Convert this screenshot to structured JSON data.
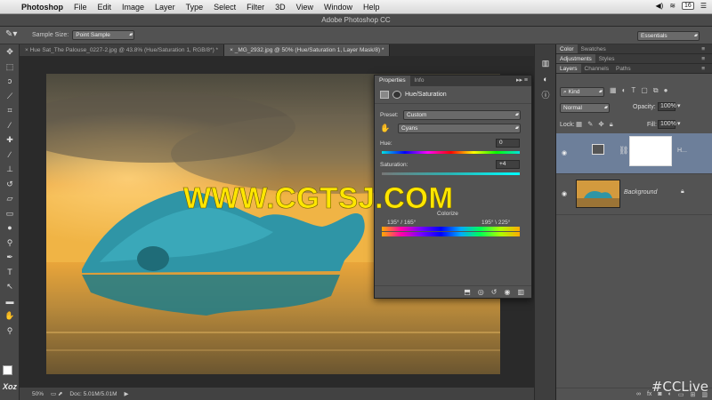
{
  "menubar": {
    "app": "Photoshop",
    "items": [
      "File",
      "Edit",
      "Image",
      "Layer",
      "Type",
      "Select",
      "Filter",
      "3D",
      "View",
      "Window",
      "Help"
    ],
    "calendar_day": "16"
  },
  "window": {
    "title": "Adobe Photoshop CC"
  },
  "options": {
    "sample_size_label": "Sample Size:",
    "sample_size_value": "Point Sample",
    "workspace": "Essentials"
  },
  "doc_tabs": [
    {
      "label": "Hue Sat_The Palouse_0227-2.jpg @ 43.8% (Hue/Saturation 1, RGB/8*) *"
    },
    {
      "label": "_MG_2932.jpg @ 50% (Hue/Saturation 1, Layer Mask/8) *"
    }
  ],
  "status": {
    "zoom": "50%",
    "doc": "Doc: 5.01M/5.01M"
  },
  "properties": {
    "tabs": [
      "Properties",
      "Info"
    ],
    "adjustment": "Hue/Saturation",
    "preset_label": "Preset:",
    "preset_value": "Custom",
    "channel": "Cyans",
    "hue_label": "Hue:",
    "hue_value": "0",
    "saturation_label": "Saturation:",
    "saturation_value": "+4",
    "colorize_label": "Colorize",
    "range_left": "135° / 165°",
    "range_right": "195° \\ 225°"
  },
  "right": {
    "top_tabs": [
      "Color",
      "Swatches"
    ],
    "mid_tabs": [
      "Adjustments",
      "Styles"
    ],
    "layer_tabs": [
      "Layers",
      "Channels",
      "Paths"
    ],
    "kind": "Kind",
    "blend_mode": "Normal",
    "opacity_label": "Opacity:",
    "opacity_value": "100%",
    "lock_label": "Lock:",
    "fill_label": "Fill:",
    "fill_value": "100%",
    "layers": [
      {
        "name": "H..."
      },
      {
        "name": "Background"
      }
    ]
  },
  "overlay": {
    "watermark": "WWW.CGTSJ.COM",
    "tag": "#CCLive",
    "logo": "Xoz"
  },
  "colors": {
    "accent_selected": "#6d7f9a",
    "iceberg": "#3aa3b3",
    "sky_warm": "#e79a2a"
  }
}
